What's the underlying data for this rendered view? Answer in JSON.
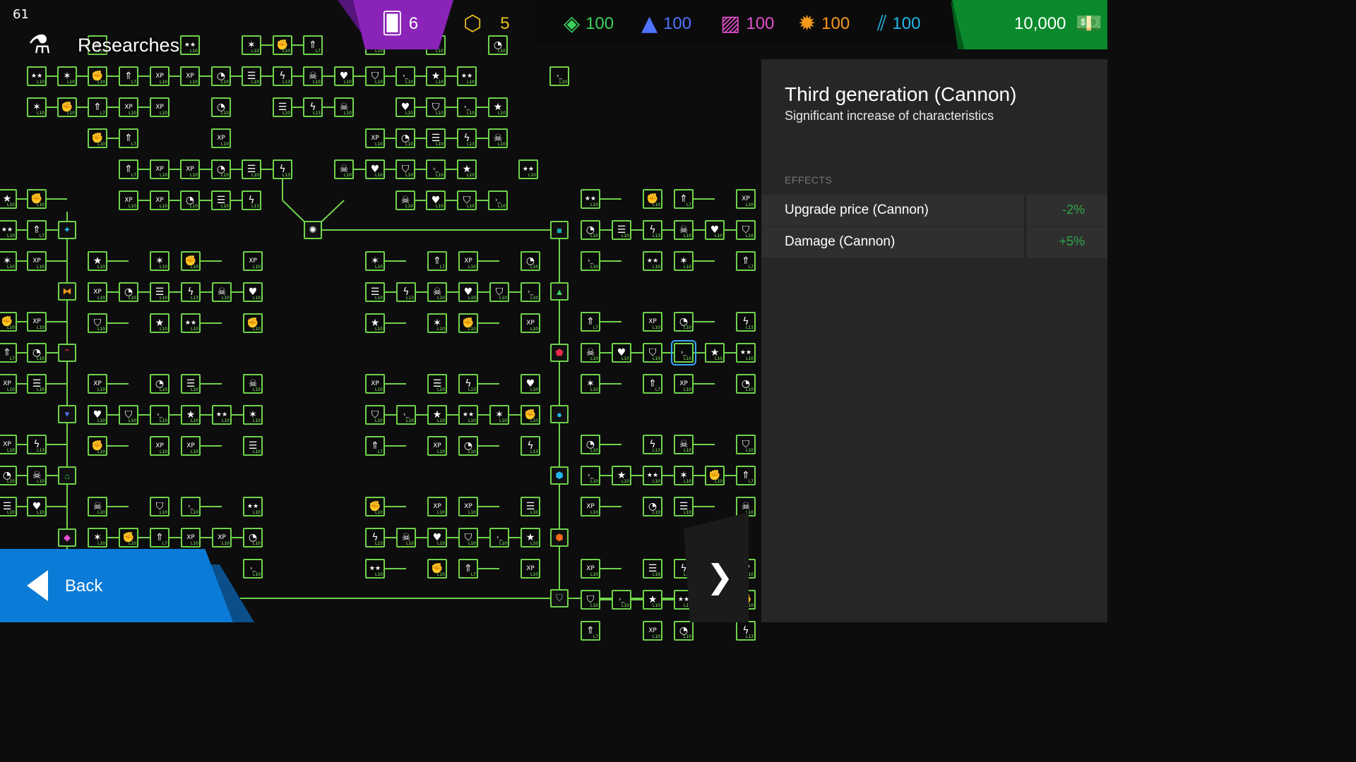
{
  "fps": "61",
  "screen_title": "Researches",
  "resources": {
    "cards": {
      "value": "6",
      "icon": "cards-plus-icon",
      "color": "#ffffff"
    },
    "tokens": {
      "value": "5",
      "icon": "hex-token-icon",
      "color": "#f2c21a"
    },
    "green": {
      "value": "100",
      "icon": "green-material-icon",
      "color": "#3bd15a"
    },
    "blue": {
      "value": "100",
      "icon": "blue-material-icon",
      "color": "#4f73ff"
    },
    "pink": {
      "value": "100",
      "icon": "pink-material-icon",
      "color": "#e44fd0"
    },
    "orange": {
      "value": "100",
      "icon": "orange-material-icon",
      "color": "#f59a1c"
    },
    "cyan": {
      "value": "100",
      "icon": "cyan-material-icon",
      "color": "#22b7e8"
    },
    "money": {
      "value": "10,000",
      "icon": "money-icon",
      "color": "#ffffff"
    }
  },
  "detail": {
    "title": "Third generation (Cannon)",
    "subtitle": "Significant increase of characteristics",
    "effects_header": "EFFECTS",
    "effects": [
      {
        "label": "Upgrade price (Cannon)",
        "value": "-2%"
      },
      {
        "label": "Damage (Cannon)",
        "value": "+5%"
      }
    ]
  },
  "back_label": "Back",
  "next_icon": "chevron-right-icon",
  "research_nodes": [
    {
      "icon": "star-icon",
      "level": "L10"
    },
    {
      "icon": "two-stars-icon",
      "level": "L10"
    },
    {
      "icon": "three-stars-icon",
      "level": "L10"
    },
    {
      "icon": "fist-icon",
      "level": "L10"
    },
    {
      "icon": "arrow-up-icon",
      "level": "L7"
    },
    {
      "icon": "xp-icon",
      "level": "L10"
    },
    {
      "icon": "max-xp-icon",
      "level": "L10"
    },
    {
      "icon": "gauge-icon",
      "level": "L10"
    },
    {
      "icon": "list-icon",
      "level": "L10"
    },
    {
      "icon": "lightning-icon",
      "level": "L13"
    },
    {
      "icon": "skull-icon",
      "level": "L10"
    },
    {
      "icon": "heart-icon",
      "level": "L10"
    },
    {
      "icon": "shield-icon",
      "level": "L10"
    },
    {
      "icon": "terminal-icon",
      "level": "L10"
    }
  ]
}
